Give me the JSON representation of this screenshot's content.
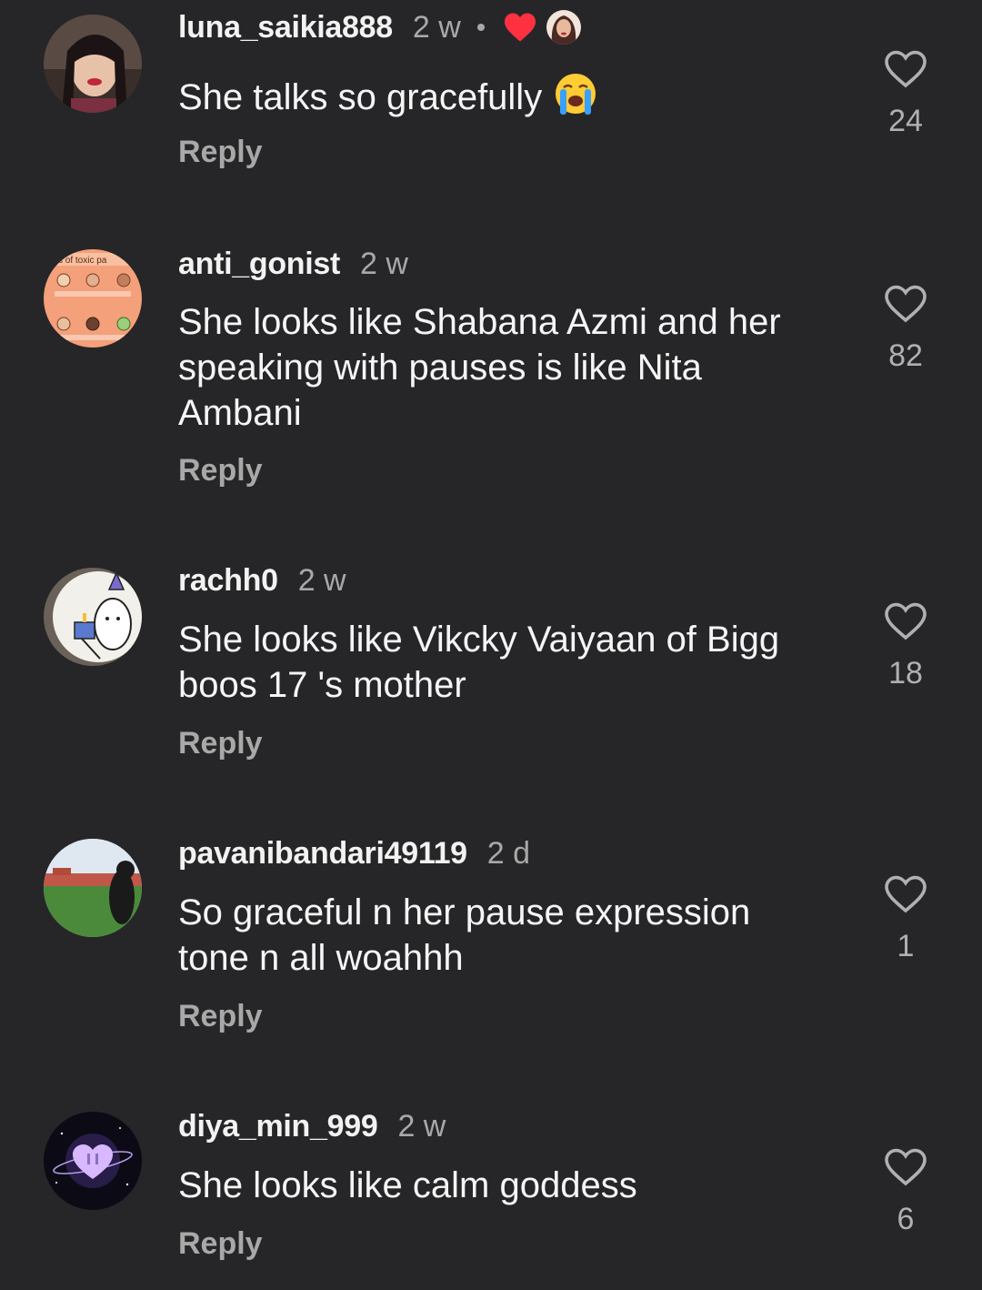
{
  "comments": [
    {
      "username": "luna_saikia888",
      "time": "2 w",
      "text": "She talks so gracefully",
      "reply_label": "Reply",
      "likes": "24",
      "liked_by_creator": true,
      "emoji": "loudly-crying-face"
    },
    {
      "username": "anti_gonist",
      "time": "2 w",
      "text": "She looks like Shabana Azmi and her speaking with pauses is like Nita Ambani",
      "reply_label": "Reply",
      "likes": "82",
      "avatar_text": "s of toxic pa"
    },
    {
      "username": "rachh0",
      "time": "2 w",
      "text": "She looks like Vikcky Vaiyaan of Bigg boos 17 's mother",
      "reply_label": "Reply",
      "likes": "18"
    },
    {
      "username": "pavanibandari49119",
      "time": "2 d",
      "text": "So graceful n her pause expression tone n all woahhh",
      "reply_label": "Reply",
      "likes": "1"
    },
    {
      "username": "diya_min_999",
      "time": "2 w",
      "text": "She looks like calm goddess",
      "reply_label": "Reply",
      "likes": "6"
    }
  ],
  "colors": {
    "background": "#262628",
    "primary_text": "#f5f5f5",
    "secondary_text": "#a8a8a8",
    "liked_heart": "#ff3040"
  }
}
